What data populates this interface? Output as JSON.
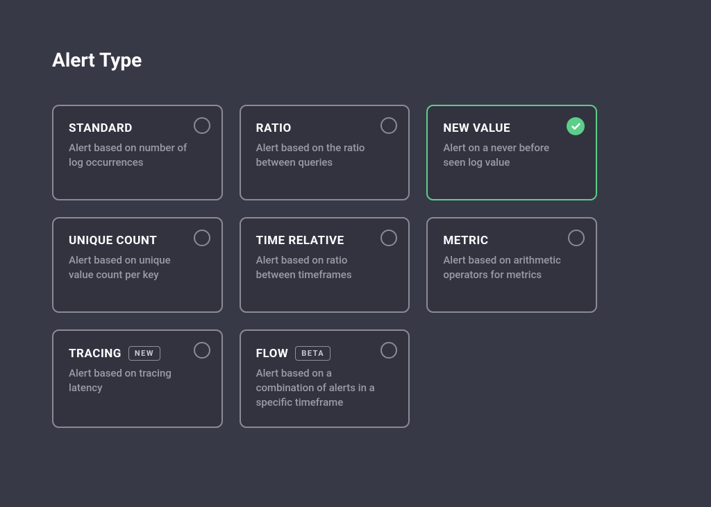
{
  "section": {
    "title": "Alert Type"
  },
  "options": {
    "standard": {
      "title": "STANDARD",
      "desc": "Alert based on number of log occurrences",
      "selected": false
    },
    "ratio": {
      "title": "RATIO",
      "desc": "Alert based on the ratio between queries",
      "selected": false
    },
    "new_value": {
      "title": "NEW VALUE",
      "desc": "Alert on a never before seen log value",
      "selected": true
    },
    "unique_count": {
      "title": "UNIQUE COUNT",
      "desc": "Alert based on unique value count per key",
      "selected": false
    },
    "time_relative": {
      "title": "TIME RELATIVE",
      "desc": "Alert based on ratio between timeframes",
      "selected": false
    },
    "metric": {
      "title": "METRIC",
      "desc": "Alert based on arithmetic operators for metrics",
      "selected": false
    },
    "tracing": {
      "title": "TRACING",
      "badge": "NEW",
      "desc": "Alert based on tracing latency",
      "selected": false
    },
    "flow": {
      "title": "FLOW",
      "badge": "BETA",
      "desc": "Alert based on a combination of alerts in a specific timeframe",
      "selected": false
    }
  }
}
